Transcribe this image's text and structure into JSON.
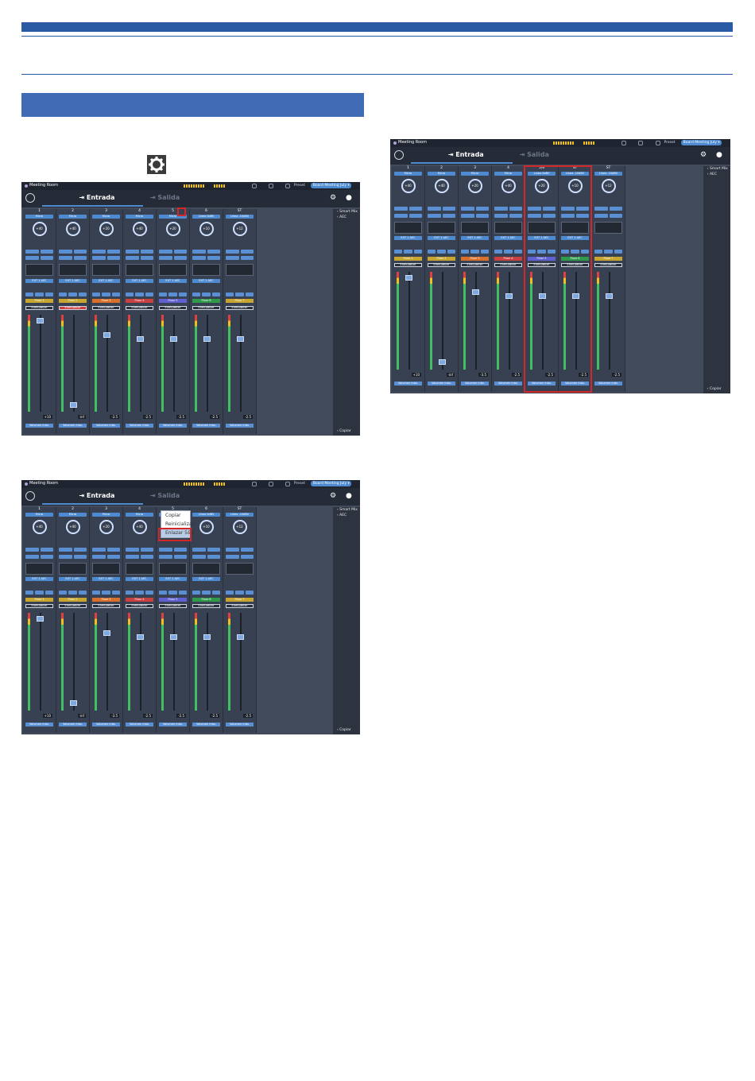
{
  "screenshots": [
    {
      "room": "Meeting Room",
      "preset_label": "Preset",
      "preset_value": "Board Meeting July",
      "tab_input": "Entrada",
      "tab_output": "Salida",
      "side_items": [
        "Smart Mix",
        "AEC"
      ],
      "side_bottom": "Copiar",
      "channels": [
        {
          "num": "1",
          "type": "Micro",
          "gain": "+40",
          "dyn": "EXT 1 AEC",
          "floor": "Floor 1",
          "fader": "+10",
          "mute": false
        },
        {
          "num": "2",
          "type": "Micro",
          "gain": "+40",
          "dyn": "EXT 1 AEC",
          "floor": "Floor 2",
          "fader": "-inf",
          "mute": true
        },
        {
          "num": "3",
          "type": "Micro",
          "gain": "+20",
          "dyn": "EXT 1 AEC",
          "floor": "Floor 3",
          "fader": "-3.5",
          "mute": false
        },
        {
          "num": "4",
          "type": "Micro",
          "gain": "+40",
          "dyn": "EXT 1 AEC",
          "floor": "Floor 4",
          "fader": "-2.5",
          "mute": false
        },
        {
          "num": "5",
          "type": "Micro",
          "gain": "+20",
          "dyn": "EXT 1 AEC",
          "floor": "Floor 5",
          "fader": "-2.5",
          "mute": false
        },
        {
          "num": "6",
          "type": "Línea 0dBV",
          "gain": "+10",
          "dyn": "EXT 1 AEC",
          "floor": "Floor 6",
          "fader": "-2.5",
          "mute": false
        },
        {
          "num": "ST",
          "type": "Línea -10dBV",
          "gain": "+12",
          "dyn": "",
          "floor": "Floor 7",
          "fader": "-2.5",
          "mute": false
        }
      ],
      "max_volume_label": "Volumen máx.",
      "fade_label": "Enmudecer"
    },
    {
      "room": "Meeting Room",
      "preset_label": "Preset",
      "preset_value": "Board Meeting July",
      "tab_input": "Entrada",
      "tab_output": "Salida",
      "side_items": [
        "Smart Mix",
        "AEC"
      ],
      "side_bottom": "Copiar",
      "menu": [
        "Copiar",
        "Reinicializar",
        "Enlazar 5&6"
      ]
    },
    {
      "room": "Meeting Room",
      "preset_label": "Preset",
      "preset_value": "Board Meeting July",
      "tab_input": "Entrada",
      "tab_output": "Salida",
      "side_items": [
        "Smart Mix",
        "AEC"
      ],
      "side_bottom": "Copiar",
      "channels_top": [
        {
          "num": "1",
          "type": "Micro"
        },
        {
          "num": "2",
          "type": "Micro"
        },
        {
          "num": "3",
          "type": "Micro"
        },
        {
          "num": "4",
          "type": "Micro"
        },
        {
          "num": "5/6",
          "type": "Línea 0dBV"
        },
        {
          "num": "ST",
          "type": "Línea -10dBV"
        }
      ]
    }
  ],
  "colors": {
    "primary_bar": "#2b5aa5",
    "section_bar": "#3f6cb5",
    "app_bg": "#414b5c",
    "highlight": "#d42828"
  }
}
